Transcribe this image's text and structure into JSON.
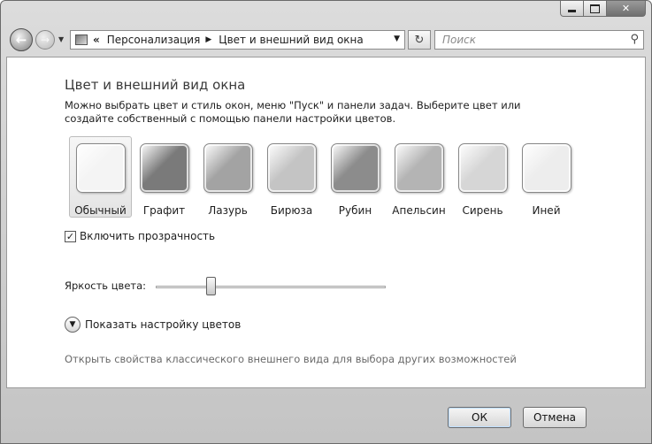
{
  "navigation": {
    "breadcrumb_prefix": "«",
    "crumbs": [
      "Персонализация",
      "Цвет и внешний вид окна"
    ],
    "search_placeholder": "Поиск"
  },
  "page": {
    "title": "Цвет и внешний вид окна",
    "description": "Можно выбрать цвет и стиль окон, меню \"Пуск\" и панели задач. Выберите цвет или создайте собственный с помощью панели настройки цветов.",
    "selected_scheme": "Обычный",
    "color_schemes": [
      {
        "label": "Обычный",
        "color": "#f4f4f4"
      },
      {
        "label": "Графит",
        "color": "#7a7a7a"
      },
      {
        "label": "Лазурь",
        "color": "#a3a3a3"
      },
      {
        "label": "Бирюза",
        "color": "#c4c4c4"
      },
      {
        "label": "Рубин",
        "color": "#8c8c8c"
      },
      {
        "label": "Апельсин",
        "color": "#b4b4b4"
      },
      {
        "label": "Сирень",
        "color": "#d6d6d6"
      },
      {
        "label": "Иней",
        "color": "#ededed"
      }
    ],
    "transparency": {
      "label": "Включить прозрачность",
      "checked": true
    },
    "brightness": {
      "label": "Яркость цвета:",
      "level": 0.24
    },
    "show_color_settings": "Показать настройку цветов",
    "classic_link": "Открыть свойства классического внешнего вида для выбора других возможностей"
  },
  "buttons": {
    "ok": "ОК",
    "cancel": "Отмена"
  }
}
